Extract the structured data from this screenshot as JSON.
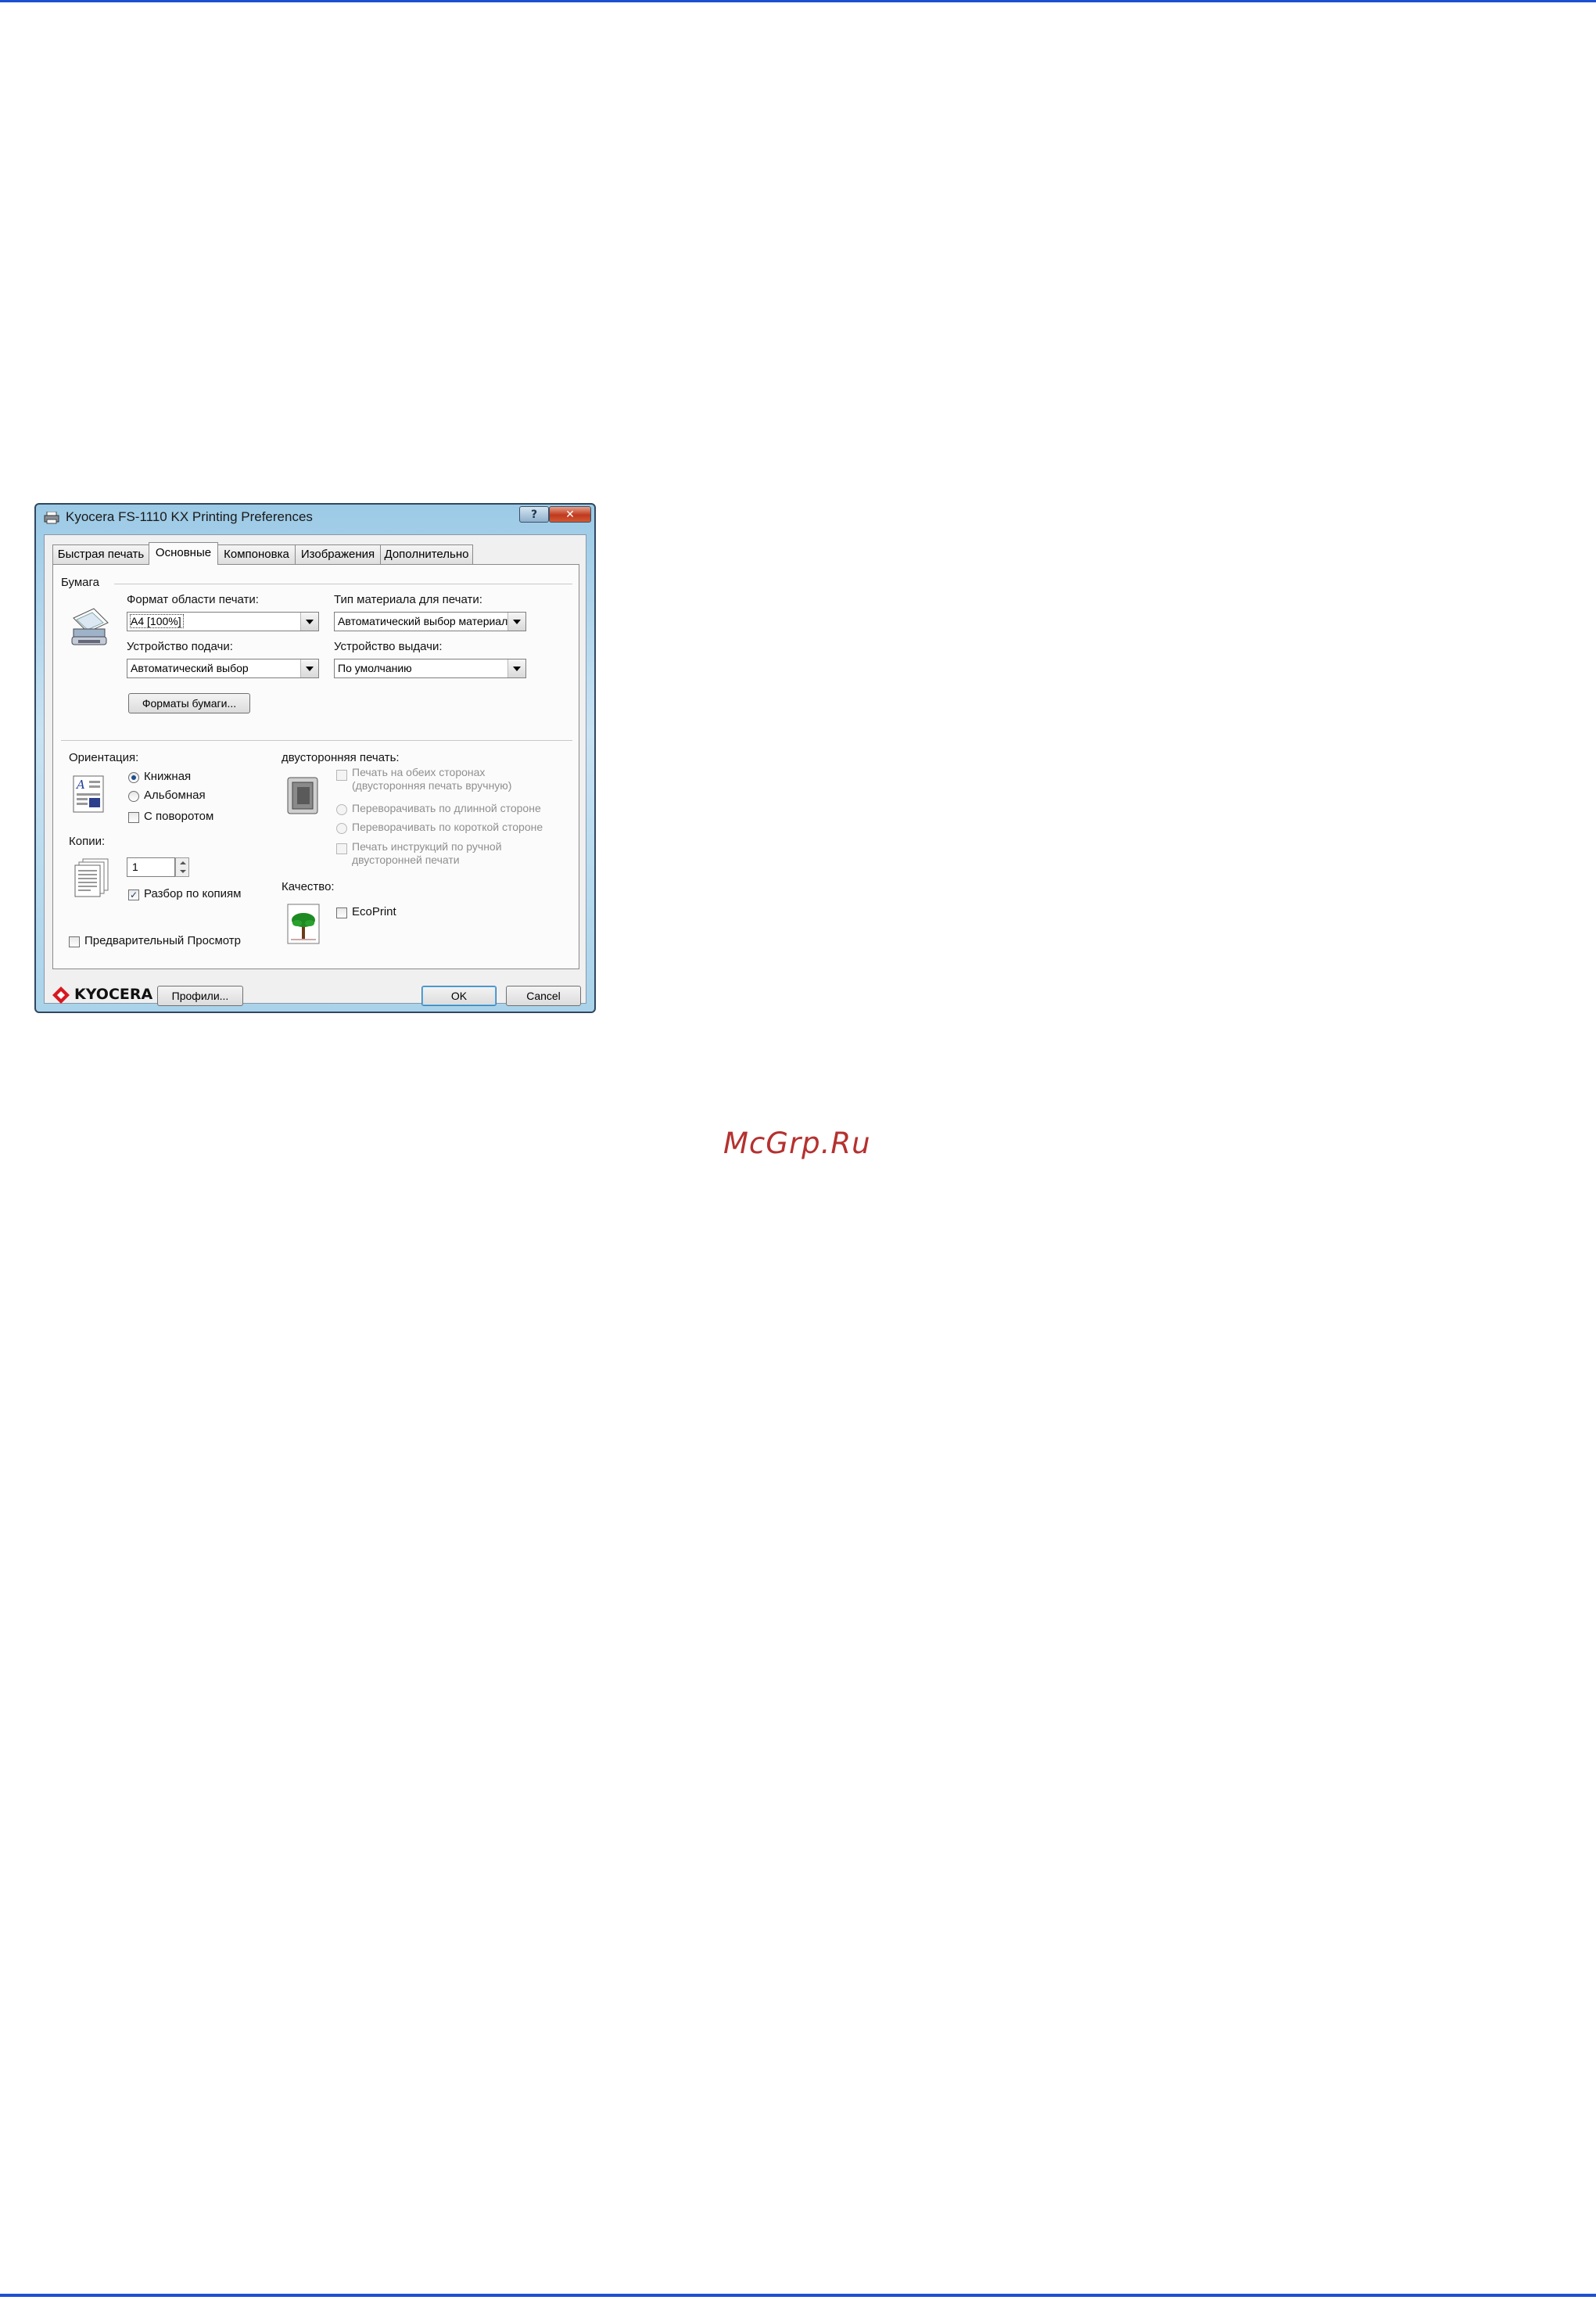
{
  "window": {
    "title": "Kyocera FS-1110 KX Printing Preferences",
    "help_label": "?",
    "close_label": "✕"
  },
  "tabs": [
    {
      "label": "Быстрая печать"
    },
    {
      "label": "Основные"
    },
    {
      "label": "Компоновка"
    },
    {
      "label": "Изображения"
    },
    {
      "label": "Дополнительно"
    }
  ],
  "active_tab": "Основные",
  "paper": {
    "group_label": "Бумага",
    "print_size_label": "Формат области печати:",
    "print_size_value": "A4  [100%]",
    "media_type_label": "Тип материала для печати:",
    "media_type_value": "Автоматический выбор материала",
    "source_label": "Устройство подачи:",
    "source_value": "Автоматический выбор",
    "output_label": "Устройство выдачи:",
    "output_value": "По умолчанию",
    "paper_sizes_button": "Форматы бумаги..."
  },
  "orientation": {
    "label": "Ориентация:",
    "portrait": "Книжная",
    "landscape": "Альбомная",
    "rotated": "С поворотом",
    "selected": "Книжная"
  },
  "copies": {
    "label": "Копии:",
    "value": "1",
    "collate": "Разбор по копиям",
    "collate_checked": true
  },
  "preview": {
    "label": "Предварительный Просмотр",
    "checked": false
  },
  "duplex": {
    "label": "двусторонняя печать:",
    "manual_line1": "Печать на обеих сторонах",
    "manual_line2": "(двусторонняя печать вручную)",
    "flip_long": "Переворачивать по длинной стороне",
    "flip_short": "Переворачивать по короткой стороне",
    "instructions_line1": "Печать инструкций по ручной",
    "instructions_line2": "двусторонней печати"
  },
  "quality": {
    "label": "Качество:",
    "ecoprint": "EcoPrint",
    "ecoprint_checked": false
  },
  "footer": {
    "brand": "KYOCERA",
    "profiles_button": "Профили...",
    "ok_button": "OK",
    "cancel_button": "Cancel"
  },
  "watermark": "McGrp.Ru",
  "colors": {
    "page_rule": "#1d4fd1",
    "watermark": "#b5312f",
    "kyocera_red": "#d71920"
  }
}
